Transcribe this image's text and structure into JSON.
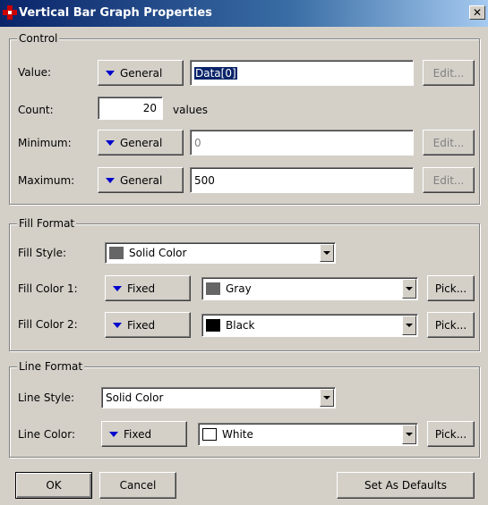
{
  "window": {
    "title": "Vertical Bar Graph Properties",
    "close_glyph": "✕"
  },
  "control": {
    "legend": "Control",
    "value": {
      "label": "Value:",
      "source": "General",
      "field": "Data[0]",
      "edit": "Edit..."
    },
    "count": {
      "label": "Count:",
      "field": "20",
      "suffix": "values"
    },
    "minimum": {
      "label": "Minimum:",
      "source": "General",
      "field": "0",
      "edit": "Edit..."
    },
    "maximum": {
      "label": "Maximum:",
      "source": "General",
      "field": "500",
      "edit": "Edit..."
    }
  },
  "fill_format": {
    "legend": "Fill Format",
    "style": {
      "label": "Fill Style:",
      "value": "Solid Color",
      "swatch": "#666666"
    },
    "color1": {
      "label": "Fill Color 1:",
      "source": "Fixed",
      "value": "Gray",
      "swatch": "#666666",
      "pick": "Pick..."
    },
    "color2": {
      "label": "Fill Color 2:",
      "source": "Fixed",
      "value": "Black",
      "swatch": "#000000",
      "pick": "Pick..."
    }
  },
  "line_format": {
    "legend": "Line Format",
    "style": {
      "label": "Line Style:",
      "value": "Solid Color"
    },
    "color": {
      "label": "Line Color:",
      "source": "Fixed",
      "value": "White",
      "swatch": "#ffffff",
      "pick": "Pick..."
    }
  },
  "footer": {
    "ok": "OK",
    "cancel": "Cancel",
    "defaults": "Set As Defaults"
  }
}
